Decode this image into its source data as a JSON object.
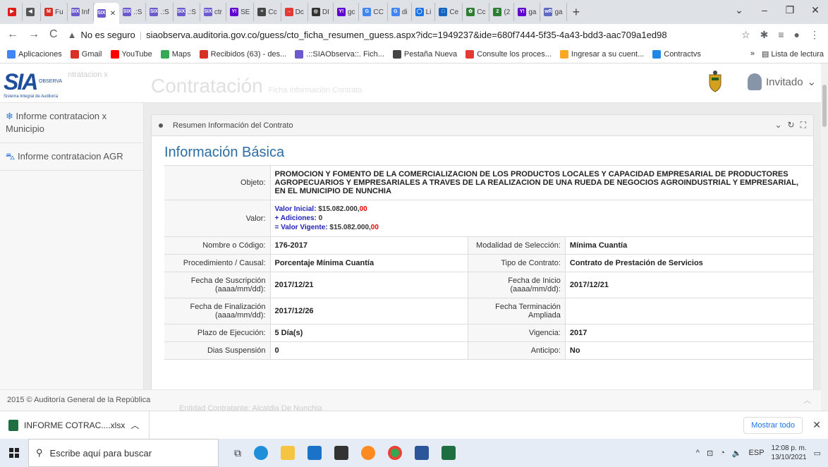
{
  "browser": {
    "tabs": [
      {
        "label": "",
        "color": "#e21b1b",
        "glyph": "▶"
      },
      {
        "label": "",
        "color": "#555",
        "glyph": "◀"
      },
      {
        "label": "Fu",
        "color": "#d93025",
        "glyph": "M"
      },
      {
        "label": "Inf",
        "color": "#6a5acd",
        "glyph": "SIX"
      },
      {
        "label": "",
        "color": "#6a5acd",
        "glyph": "SIX",
        "active": true
      },
      {
        "label": ".:S",
        "color": "#6a5acd",
        "glyph": "SIX"
      },
      {
        "label": ".:S",
        "color": "#6a5acd",
        "glyph": "SIX"
      },
      {
        "label": ".:S",
        "color": "#6a5acd",
        "glyph": "SIX"
      },
      {
        "label": "ctr",
        "color": "#6a5acd",
        "glyph": "SIX"
      },
      {
        "label": "SE",
        "color": "#6001d2",
        "glyph": "Y!"
      },
      {
        "label": "Cc",
        "color": "#444",
        "glyph": "≡"
      },
      {
        "label": "Dc",
        "color": "#e53935",
        "glyph": "→"
      },
      {
        "label": "DI",
        "color": "#333",
        "glyph": "◎"
      },
      {
        "label": "gc",
        "color": "#6001d2",
        "glyph": "Y!"
      },
      {
        "label": "CC",
        "color": "#4285f4",
        "glyph": "G"
      },
      {
        "label": "di",
        "color": "#4285f4",
        "glyph": "G"
      },
      {
        "label": "Li",
        "color": "#1a73e8",
        "glyph": "◯"
      },
      {
        "label": "Ce",
        "color": "#1565c0",
        "glyph": "□"
      },
      {
        "label": "Cc",
        "color": "#2e7d32",
        "glyph": "✿"
      },
      {
        "label": "(2",
        "color": "#2e7d32",
        "glyph": "2"
      },
      {
        "label": "ga",
        "color": "#6001d2",
        "glyph": "Y!"
      },
      {
        "label": "ga",
        "color": "#5c6bc0",
        "glyph": "wR"
      }
    ],
    "new_tab": "+",
    "url_warning": "No es seguro",
    "url": "siaobserva.auditoria.gov.co/guess/cto_ficha_resumen_guess.aspx?idc=1949237&ide=680f7444-5f35-4a43-bdd3-aac709a1ed98",
    "bookmarks": [
      {
        "label": "Aplicaciones",
        "icon": "apps-icon"
      },
      {
        "label": "Gmail",
        "icon": "gmail-icon"
      },
      {
        "label": "YouTube",
        "icon": "youtube-icon"
      },
      {
        "label": "Maps",
        "icon": "maps-icon"
      },
      {
        "label": "Recibidos (63) - des...",
        "icon": "gmail-icon"
      },
      {
        "label": ".::SIAObserva::. Fich...",
        "icon": "sia-icon"
      },
      {
        "label": "Pestaña Nueva",
        "icon": "chrome-icon"
      },
      {
        "label": "Consulte los proces...",
        "icon": "login-icon"
      },
      {
        "label": "Ingresar a su cuent...",
        "icon": "hat-icon"
      },
      {
        "label": "Contractvs",
        "icon": "gear-icon"
      }
    ],
    "reading_list": "Lista de lectura"
  },
  "header": {
    "logo_text": "SIA",
    "logo_obs": "OBSERVA",
    "logo_sub": "Sistema Integral de Auditoría",
    "ghost": "ntratacion x",
    "title": "Contratación",
    "subtitle": "Ficha Información Contrato",
    "user": "Invitado"
  },
  "sidebar": {
    "items": [
      {
        "label": "Informe contratacion x Municipio",
        "icon": "gear-icon"
      },
      {
        "label": "Informe contratacion AGR",
        "icon": "car-icon"
      }
    ]
  },
  "panel": {
    "title": "Resumen Información del Contrato",
    "section": "Información Básica",
    "objeto_label": "Objeto:",
    "objeto": "PROMOCION Y FOMENTO DE LA COMERCIALIZACION DE LOS PRODUCTOS LOCALES Y CAPACIDAD EMPRESARIAL DE PRODUCTORES AGROPECUARIOS Y EMPRESARIALES A TRAVES DE LA REALIZACION DE UNA RUEDA DE NEGOCIOS AGROINDUSTRIAL Y EMPRESARIAL, EN EL MUNICIPIO DE NUNCHIA",
    "valor_label": "Valor:",
    "valor_inicial_label": "Valor Inicial:",
    "valor_inicial": "$15.082.000,",
    "valor_inicial_cents": "00",
    "adiciones_label": "+ Adiciones:",
    "adiciones": "0",
    "vigente_label": "= Valor Vigente:",
    "vigente": "$15.082.000,",
    "vigente_cents": "00",
    "rows": [
      {
        "l1": "Nombre o Código:",
        "v1": "176-2017",
        "l2": "Modalidad de Selección:",
        "v2": "Mínima Cuantía"
      },
      {
        "l1": "Procedimiento / Causal:",
        "v1": "Porcentaje Mínima Cuantía",
        "l2": "Tipo de Contrato:",
        "v2": "Contrato de Prestación de Servicios"
      },
      {
        "l1": "Fecha de Suscripción (aaaa/mm/dd):",
        "v1": "2017/12/21",
        "l2": "Fecha de Inicio (aaaa/mm/dd):",
        "v2": "2017/12/21"
      },
      {
        "l1": "Fecha de Finalización (aaaa/mm/dd):",
        "v1": "2017/12/26",
        "l2": "Fecha Terminación Ampliada",
        "v2": ""
      },
      {
        "l1": "Plazo de Ejecución:",
        "v1": "5 Día(s)",
        "l2": "Vigencia:",
        "v2": "2017"
      },
      {
        "l1": "Dias Suspensión",
        "v1": "0",
        "l2": "Anticipo:",
        "v2": "No"
      }
    ]
  },
  "footer": {
    "copyright": "2015 © Auditoría General de la República",
    "ghost_label": "Entidad Contratante:",
    "ghost_value": "Alcaldia De Nunchia"
  },
  "downloads": {
    "file": "INFORME COTRAC....xlsx",
    "show_all": "Mostrar todo"
  },
  "taskbar": {
    "search_placeholder": "Escribe aquí para buscar",
    "lang": "ESP",
    "time": "12:08 p. m.",
    "date": "13/10/2021"
  }
}
